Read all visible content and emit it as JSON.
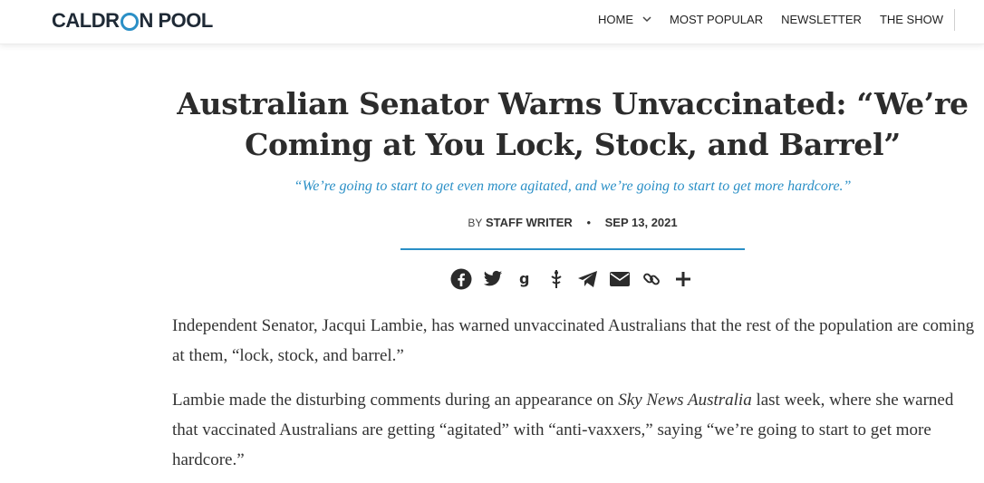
{
  "header": {
    "logo_left": "CALDR",
    "logo_right": "N POOL",
    "nav": [
      "HOME",
      "MOST POPULAR",
      "NEWSLETTER",
      "THE SHOW"
    ]
  },
  "article": {
    "title_line1": "Australian Senator Warns Unvaccinated: “We’re",
    "title_line2": "Coming at You Lock, Stock, and Barrel”",
    "subtitle": "“We’re going to start to get even more agitated, and we’re going to start to get more hardcore.”",
    "by_label": "BY",
    "author": "STAFF WRITER",
    "separator": "•",
    "date": "SEP 13, 2021",
    "share_icons": [
      "facebook-icon",
      "twitter-icon",
      "gettr-icon",
      "gab-icon",
      "telegram-icon",
      "email-icon",
      "copy-link-icon",
      "more-plus-icon"
    ],
    "p1": "Independent Senator, Jacqui Lambie, has warned unvaccinated Australians that the rest of the population are coming at them, “lock, stock, and barrel.”",
    "p2_before": "Lambie made the disturbing comments during an appearance on ",
    "p2_em": "Sky News Australia",
    "p2_after": " last week, where she warned that vaccinated Australians are getting “agitated” with “anti-vaxxers,” saying “we’re going to start to get more hardcore.”"
  },
  "colors": {
    "accent": "#2a8fc6",
    "text": "#2c2c2c"
  }
}
